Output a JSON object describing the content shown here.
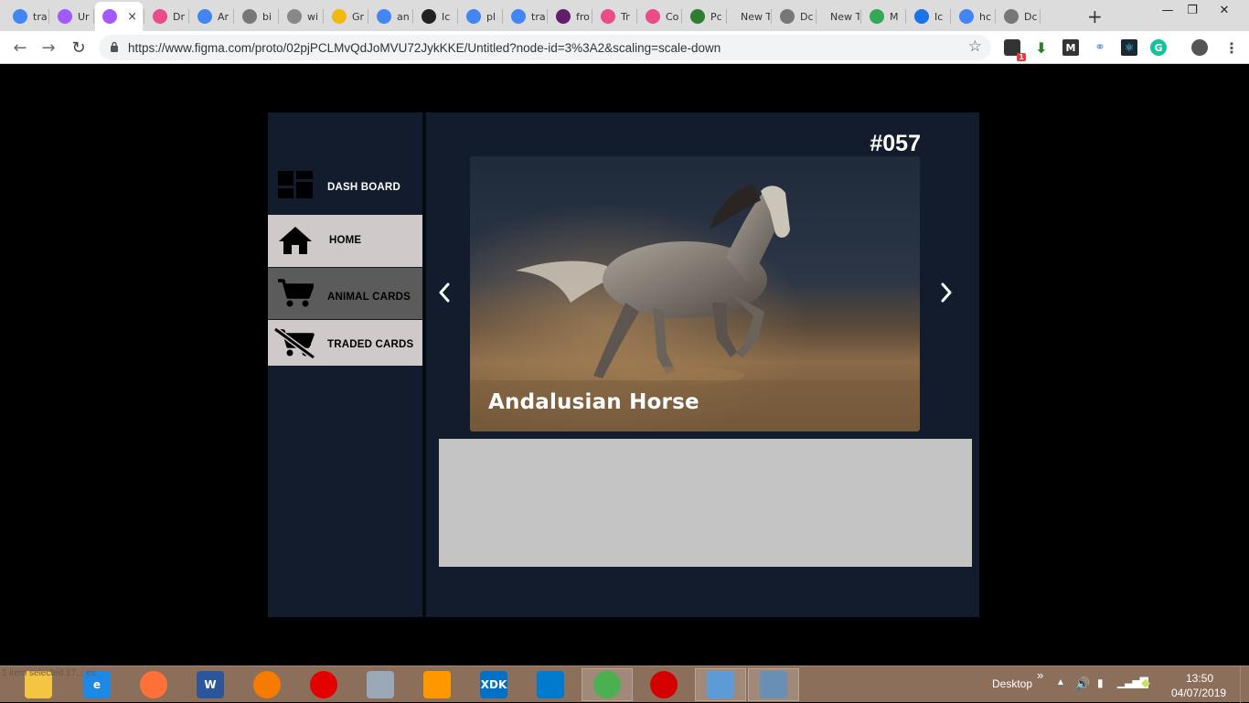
{
  "browser": {
    "tabs": [
      {
        "title": "tra",
        "icon": "google-icon",
        "color": "#4285f4"
      },
      {
        "title": "Ur",
        "icon": "figma-icon",
        "color": "#a259ff"
      },
      {
        "title": "",
        "icon": "figma-icon",
        "color": "#a259ff",
        "active": true
      },
      {
        "title": "Dr",
        "icon": "dribbble-icon",
        "color": "#ea4c89"
      },
      {
        "title": "Ar",
        "icon": "google-icon",
        "color": "#4285f4"
      },
      {
        "title": "bi",
        "icon": "globe-icon",
        "color": "#777777"
      },
      {
        "title": "wi",
        "icon": "cart-icon",
        "color": "#888888"
      },
      {
        "title": "Gr",
        "icon": "binance-icon",
        "color": "#f0b90b"
      },
      {
        "title": "an",
        "icon": "google-icon",
        "color": "#4285f4"
      },
      {
        "title": "Ic",
        "icon": "github-icon",
        "color": "#222222"
      },
      {
        "title": "pl",
        "icon": "google-icon",
        "color": "#4285f4"
      },
      {
        "title": "tra",
        "icon": "google-icon",
        "color": "#4285f4"
      },
      {
        "title": "fro",
        "icon": "slack-icon",
        "color": "#611f69"
      },
      {
        "title": "Tr",
        "icon": "dribbble-icon",
        "color": "#ea4c89"
      },
      {
        "title": "Co",
        "icon": "dribbble-icon",
        "color": "#ea4c89"
      },
      {
        "title": "Pc",
        "icon": "pc-icon",
        "color": "#2e7d32"
      },
      {
        "title": "New T",
        "icon": "",
        "color": ""
      },
      {
        "title": "Dc",
        "icon": "globe-icon",
        "color": "#777777"
      },
      {
        "title": "New T",
        "icon": "",
        "color": ""
      },
      {
        "title": "M",
        "icon": "px-icon",
        "color": "#35a853"
      },
      {
        "title": "Ic",
        "icon": "flag-icon",
        "color": "#1a73e8"
      },
      {
        "title": "hc",
        "icon": "google-icon",
        "color": "#4285f4"
      },
      {
        "title": "Dc",
        "icon": "globe-icon",
        "color": "#777777"
      }
    ],
    "close_tab": "×",
    "new_tab": "+",
    "window_controls": {
      "minimize": "—",
      "restore": "❐",
      "close": "✕"
    },
    "nav": {
      "back": "←",
      "forward": "→",
      "reload": "↻"
    },
    "url": "https://www.figma.com/proto/02pjPCLMvQdJoMVU72JykKKE/Untitled?node-id=3%3A2&scaling=scale-down",
    "star": "☆",
    "extension_badge": "1"
  },
  "app": {
    "sidebar": {
      "items": [
        {
          "label": "DASH BOARD",
          "icon": "dashboard-icon",
          "bg": "#121c2c",
          "fg": "#ffffff"
        },
        {
          "label": "HOME",
          "icon": "home-icon",
          "bg": "#cfc9c9",
          "fg": "#000000"
        },
        {
          "label": "ANIMAL CARDS",
          "icon": "cart-icon",
          "bg": "#5b5b5b",
          "fg": "#000000"
        },
        {
          "label": "TRADED CARDS",
          "icon": "cart-off-icon",
          "bg": "#cfc9c9",
          "fg": "#000000"
        }
      ]
    },
    "card": {
      "id": "#057",
      "name": "Andalusian Horse",
      "prev": "‹",
      "next": "›"
    },
    "colors": {
      "panel": "#121c2c",
      "info_box": "#c4c4c4"
    }
  },
  "taskbar": {
    "apps": [
      {
        "name": "file-explorer",
        "label": "",
        "color": "#f4c542",
        "running": false
      },
      {
        "name": "internet-explorer",
        "label": "e",
        "color": "#1e88e5",
        "running": false
      },
      {
        "name": "firefox",
        "label": "",
        "color": "#ff7139",
        "running": false
      },
      {
        "name": "word",
        "label": "W",
        "color": "#2b579a",
        "running": false
      },
      {
        "name": "uc-browser",
        "label": "",
        "color": "#f57c00",
        "running": false
      },
      {
        "name": "airtel",
        "label": "",
        "color": "#e40000",
        "running": false
      },
      {
        "name": "system-monitor",
        "label": "",
        "color": "#9aa8b8",
        "running": false
      },
      {
        "name": "media-player",
        "label": "",
        "color": "#ff9800",
        "running": false
      },
      {
        "name": "intel-xdk",
        "label": "XDK",
        "color": "#0071c5",
        "running": false
      },
      {
        "name": "vscode",
        "label": "",
        "color": "#007acc",
        "running": false
      },
      {
        "name": "chrome",
        "label": "",
        "color": "#4caf50",
        "running": true
      },
      {
        "name": "opera",
        "label": "",
        "color": "#d40000",
        "running": false
      },
      {
        "name": "control-panel",
        "label": "",
        "color": "#5c9bd6",
        "running": true
      },
      {
        "name": "photos",
        "label": "",
        "color": "#6a8fb5",
        "running": true
      }
    ],
    "desktop_label": "Desktop",
    "chevron": "»",
    "time": "13:50",
    "date": "04/07/2019",
    "ghost_status": "1 item selected  17... es"
  }
}
